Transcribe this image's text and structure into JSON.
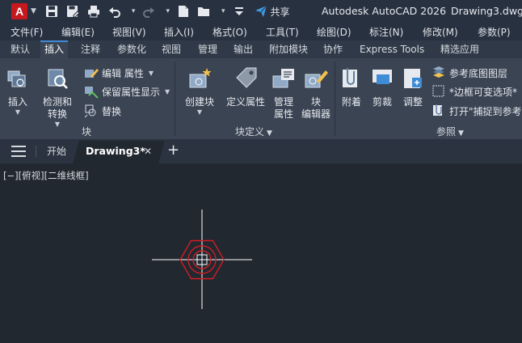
{
  "titlebar": {
    "app_logo": "A",
    "share_label": "共享",
    "app_name": "Autodesk AutoCAD 2026",
    "file_name": "Drawing3.dwg",
    "qat_icons": [
      "save-icon",
      "save-as-icon",
      "print-icon",
      "undo-icon",
      "redo-icon",
      "new-file-icon",
      "open-folder-icon",
      "customize-icon",
      "share-icon"
    ]
  },
  "menubar": {
    "items": [
      "文件(F)",
      "编辑(E)",
      "视图(V)",
      "插入(I)",
      "格式(O)",
      "工具(T)",
      "绘图(D)",
      "标注(N)",
      "修改(M)",
      "参数(P)"
    ]
  },
  "ribbon_tabs": {
    "items": [
      "默认",
      "插入",
      "注释",
      "参数化",
      "视图",
      "管理",
      "输出",
      "附加模块",
      "协作",
      "Express Tools",
      "精选应用"
    ],
    "active": "插入"
  },
  "ribbon": {
    "block_panel": {
      "title": "块",
      "insert": "插入",
      "detect_line1": "检测和",
      "detect_line2": "转换",
      "edit_attr": "编辑 属性",
      "retain_attr": "保留属性显示",
      "replace": "替换"
    },
    "block_def_panel": {
      "title": "块定义",
      "create_block": "创建块",
      "define_attr": "定义属性",
      "manage_line1": "管理",
      "manage_line2": "属性",
      "editor_line1": "块",
      "editor_line2": "编辑器"
    },
    "reference_panel": {
      "title": "参照",
      "attach": "附着",
      "clip": "剪裁",
      "adjust": "调整",
      "underlay_layers": "参考底图图层",
      "frames_variable": "*边框可变选项*",
      "snap_to": "打开\"捕捉到参考"
    }
  },
  "filetabs": {
    "start": "开始",
    "active": "Drawing3*",
    "close": "✕",
    "new": "+"
  },
  "canvas": {
    "viewport_label": "[−][俯视][二维线框]",
    "colors": {
      "background": "#212830",
      "crosshair": "#ffffff",
      "geometry": "#d11d24"
    }
  }
}
